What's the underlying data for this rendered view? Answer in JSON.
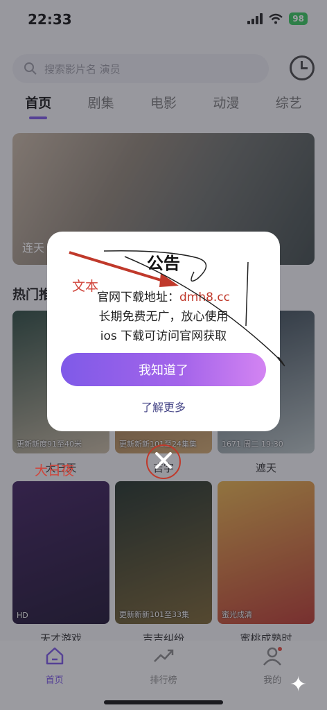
{
  "status": {
    "time": "22:33",
    "battery": "98"
  },
  "search": {
    "placeholder": "搜索影片名 演员"
  },
  "tabs": [
    {
      "label": "首页",
      "active": true
    },
    {
      "label": "剧集"
    },
    {
      "label": "电影"
    },
    {
      "label": "动漫"
    },
    {
      "label": "综艺"
    }
  ],
  "banner": {
    "title": "连天"
  },
  "section": {
    "title": "热门推"
  },
  "cards": [
    {
      "badge": "更新新度91至40米",
      "title": "大日天",
      "color1": "#2b4a3e",
      "color2": "#c7b9a0"
    },
    {
      "badge": "更新新新101至24集集",
      "title": "吉字",
      "color1": "#5c3a24",
      "color2": "#d1a86d"
    },
    {
      "badge": "1671 周二 19:30",
      "title": "遮天",
      "color1": "#2f3f4a",
      "color2": "#b9c4c4"
    },
    {
      "badge": "HD",
      "title": "天才游戏",
      "color1": "#3e1f5c",
      "color2": "#1c1230"
    },
    {
      "badge": "更新新新101至33集",
      "title": "吉吉纠纷",
      "color1": "#1f2f26",
      "color2": "#7a6430"
    },
    {
      "badge": "蜜光成清",
      "title": "蜜桃成熟时",
      "color1": "#e7b24a",
      "color2": "#b9372e"
    }
  ],
  "nav": [
    {
      "label": "首页",
      "active": true,
      "icon": "home-icon"
    },
    {
      "label": "排行榜",
      "icon": "trend-icon"
    },
    {
      "label": "我的",
      "icon": "user-icon"
    }
  ],
  "modal": {
    "title": "公告",
    "line1_prefix": "官网下载地址：",
    "line1_link": "dmh8.cc",
    "line2": "长期免费无广，放心使用",
    "line3": "ios 下载可访问官网获取",
    "ok": "我知道了",
    "more": "了解更多"
  },
  "annotations": {
    "text_label": "文本",
    "bottom_label": "大日夜"
  }
}
